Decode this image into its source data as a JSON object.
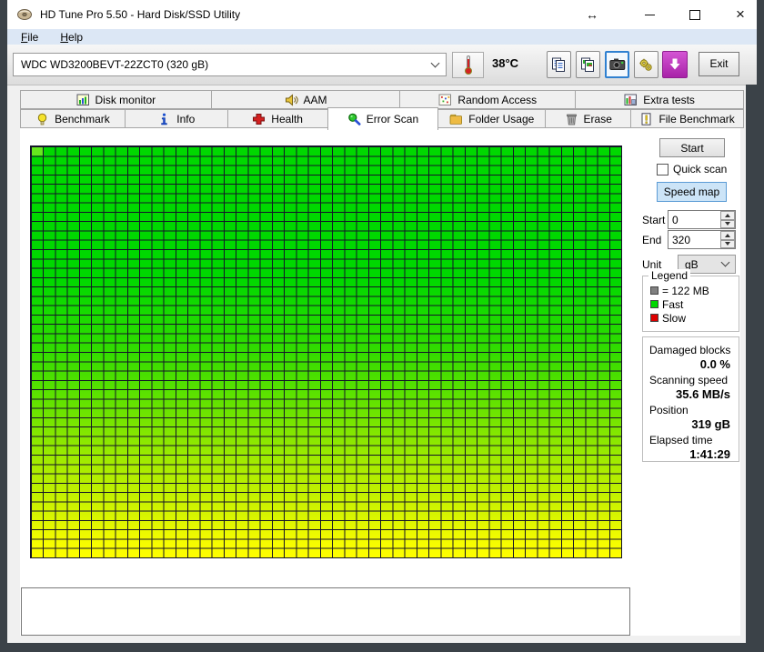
{
  "window": {
    "title": "HD Tune Pro 5.50 - Hard Disk/SSD Utility",
    "app_icon": "hard-disk-icon",
    "control_icons": {
      "resize": "↔",
      "close": "×"
    }
  },
  "menu": {
    "items": [
      "File",
      "Help"
    ]
  },
  "toolbar": {
    "drive_selector": {
      "value": "WDC WD3200BEVT-22ZCT0 (320 gB)"
    },
    "temperature": "38°C",
    "buttons": [
      {
        "icon": "copy-text-icon"
      },
      {
        "icon": "copy-image-icon"
      },
      {
        "icon": "screenshot-camera-icon",
        "selected": true
      },
      {
        "icon": "options-gears-icon"
      },
      {
        "icon": "download-update-icon",
        "color": "#bf35bf"
      }
    ],
    "exit_label": "Exit"
  },
  "tabs": {
    "active": "Error Scan",
    "row1": [
      {
        "label": "Disk monitor",
        "icon": "disk-monitor-icon"
      },
      {
        "label": "AAM",
        "icon": "speaker-icon"
      },
      {
        "label": "Random Access",
        "icon": "random-access-icon"
      },
      {
        "label": "Extra tests",
        "icon": "extra-tests-icon"
      }
    ],
    "row2": [
      {
        "label": "Benchmark",
        "icon": "lightbulb-icon"
      },
      {
        "label": "Info",
        "icon": "info-icon"
      },
      {
        "label": "Health",
        "icon": "red-cross-icon"
      },
      {
        "label": "Error Scan",
        "icon": "magnifier-icon",
        "active": true
      },
      {
        "label": "Folder Usage",
        "icon": "folder-icon"
      },
      {
        "label": "Erase",
        "icon": "trash-icon"
      },
      {
        "label": "File Benchmark",
        "icon": "file-exclaim-icon"
      }
    ]
  },
  "error_scan": {
    "start_button": "Start",
    "quick_scan": {
      "label": "Quick scan",
      "checked": false
    },
    "speed_map_button": "Speed map",
    "start_field": {
      "label": "Start",
      "value": "0"
    },
    "end_field": {
      "label": "End",
      "value": "320"
    },
    "unit_field": {
      "label": "Unit",
      "value": "gB"
    },
    "legend": {
      "title": "Legend",
      "items": [
        {
          "swatch_color": "#808080",
          "label": "= 122 MB"
        },
        {
          "swatch_color": "#00d800",
          "label": "Fast"
        },
        {
          "swatch_color": "#dd0000",
          "label": "Slow"
        }
      ]
    },
    "stats": [
      {
        "label": "Damaged blocks",
        "value": "0.0 %"
      },
      {
        "label": "Scanning speed",
        "value": "35.6 MB/s"
      },
      {
        "label": "Position",
        "value": "319 gB"
      },
      {
        "label": "Elapsed time",
        "value": "1:41:29"
      }
    ],
    "map": {
      "columns": 49,
      "rows": 44,
      "block_size_mb": 122,
      "grid_line_color": "#141428",
      "current_block_color": "#66e81e",
      "gradient_stops": [
        "#00d800 0%",
        "#00d800 32%",
        "#33dc00 50%",
        "#6ee400 65%",
        "#a8ec00 78%",
        "#d4f400 89%",
        "#f4fb00 96%",
        "#ffff00 100%"
      ]
    }
  }
}
